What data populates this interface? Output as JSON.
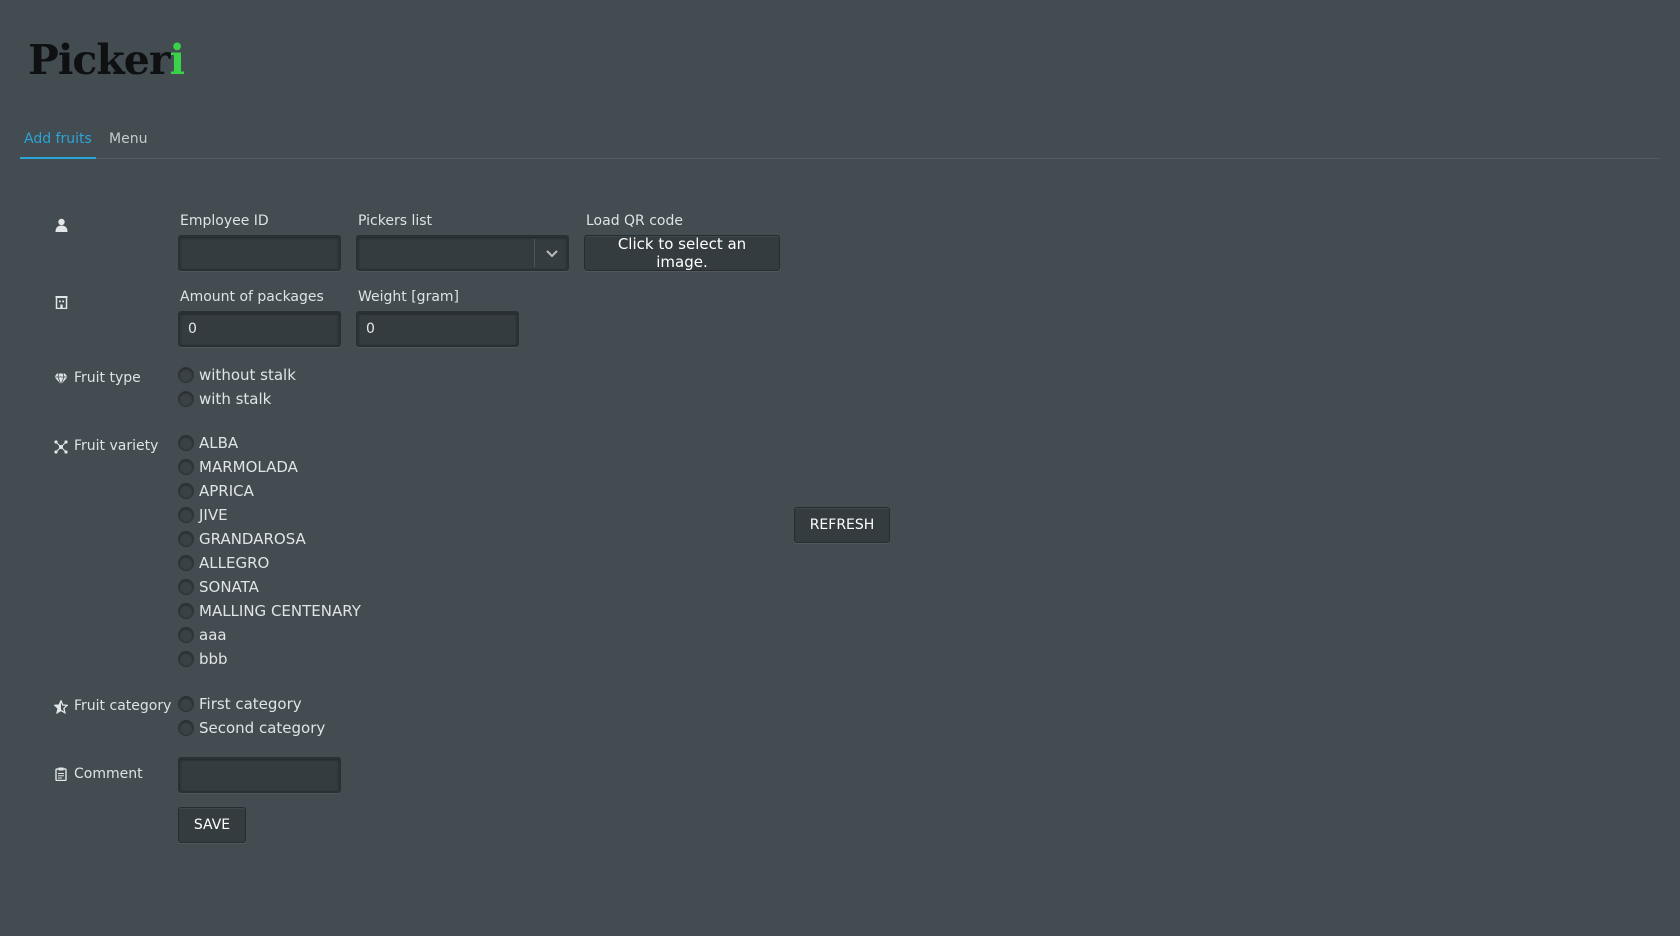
{
  "app": {
    "logo_main": "Picker",
    "logo_accent": "i"
  },
  "tabs": [
    {
      "label": "Add fruits",
      "active": true
    },
    {
      "label": "Menu",
      "active": false
    }
  ],
  "employee": {
    "employee_id_label": "Employee ID",
    "employee_id_value": "",
    "pickers_list_label": "Pickers list",
    "pickers_list_value": "",
    "qr_label": "Load QR code",
    "qr_button": "Click to select an image."
  },
  "packages": {
    "amount_label": "Amount of packages",
    "amount_value": "0",
    "weight_label": "Weight [gram]",
    "weight_value": "0"
  },
  "fruit_type": {
    "label": "Fruit type",
    "options": [
      "without stalk",
      "with stalk"
    ]
  },
  "fruit_variety": {
    "label": "Fruit variety",
    "options": [
      "ALBA",
      "MARMOLADA",
      "APRICA",
      "JIVE",
      "GRANDAROSA",
      "ALLEGRO",
      "SONATA",
      "MALLING CENTENARY",
      "aaa",
      "bbb"
    ]
  },
  "refresh_button": "REFRESH",
  "fruit_category": {
    "label": "Fruit category",
    "options": [
      "First category",
      "Second category"
    ]
  },
  "comment": {
    "label": "Comment",
    "value": ""
  },
  "save_button": "SAVE",
  "colors": {
    "background": "#424c51",
    "accent_tab": "#2ba4d8",
    "logo_accent": "#3bd14a"
  }
}
